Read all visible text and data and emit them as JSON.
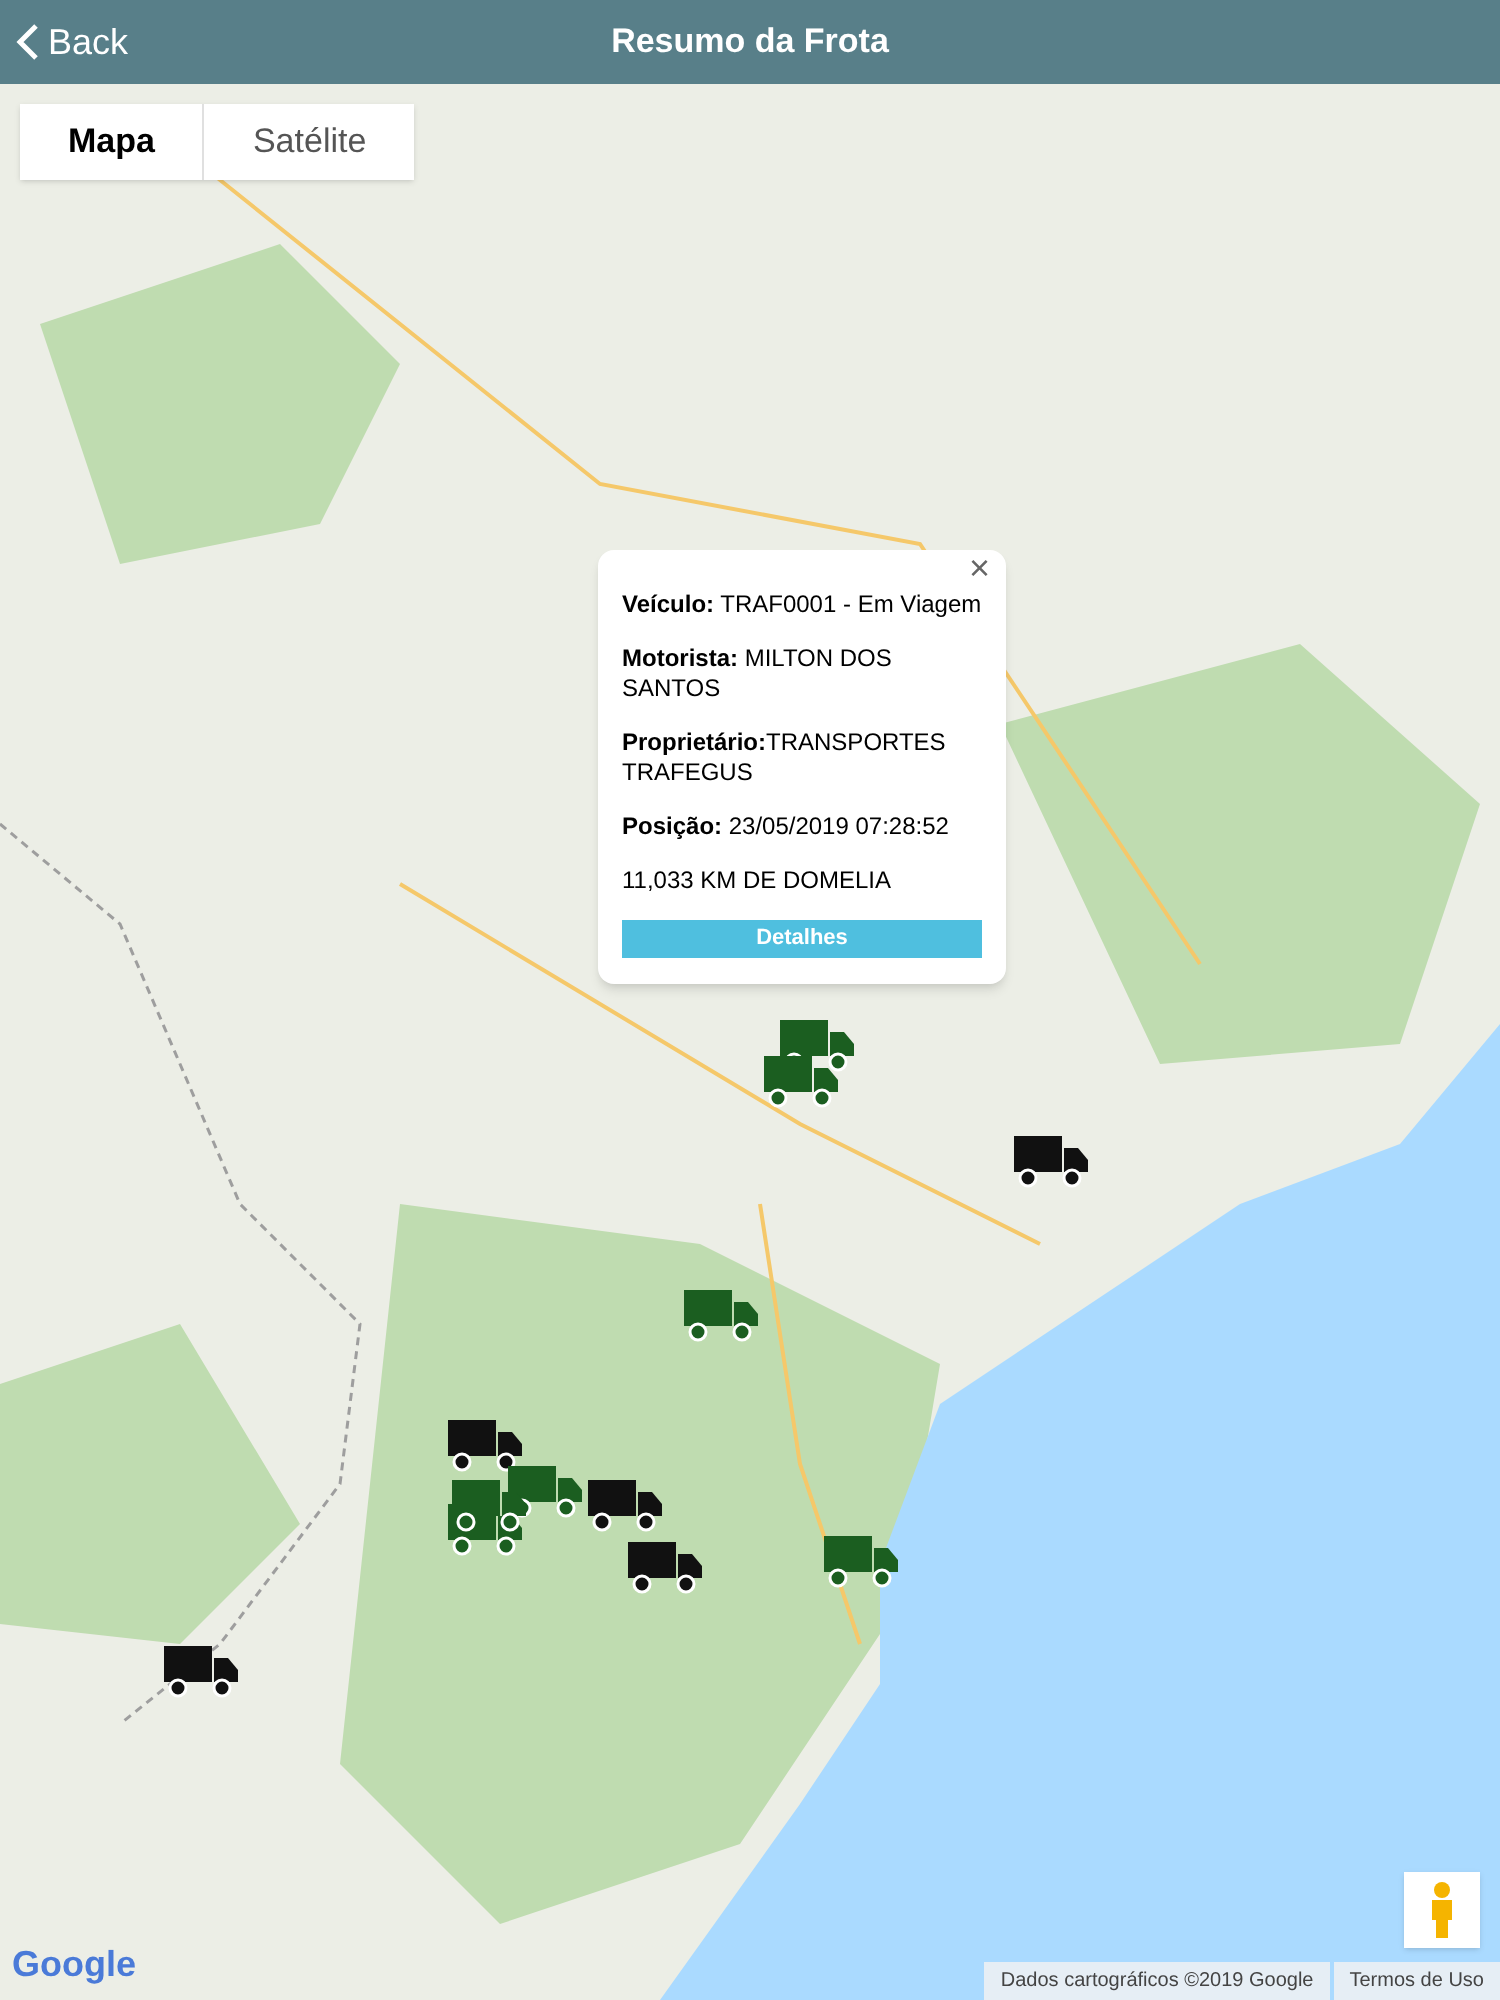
{
  "header": {
    "back_label": "Back",
    "title": "Resumo da Frota"
  },
  "map_type_tabs": [
    {
      "label": "Mapa",
      "selected": true
    },
    {
      "label": "Satélite",
      "selected": false
    }
  ],
  "info_popup": {
    "close": "×",
    "lines": [
      "**Veículo:** TRAF0001 - Em Viagem",
      "**Motorista:** MILTON DOS SANTOS",
      "**Proprietário:**TRANSPORTES TRAFEGUS",
      "**Posição:** 23/05/2019 07:28:52",
      "11,033 KM DE DOMELIA"
    ],
    "button": "Detalhes"
  },
  "markers": [
    {
      "color": "#1b5e20"
    },
    {
      "color": "#1b5e20"
    },
    {
      "color": "#111111"
    },
    {
      "color": "#1b5e20"
    },
    {
      "color": "#111111"
    },
    {
      "color": "#1b5e20"
    },
    {
      "color": "#1b5e20"
    },
    {
      "color": "#1b5e20"
    },
    {
      "color": "#111111"
    },
    {
      "color": "#111111"
    },
    {
      "color": "#1b5e20"
    },
    {
      "color": "#111111"
    }
  ],
  "footer": {
    "logo": "Google",
    "attribution": "Dados cartográficos ©2019 Google",
    "terms": "Termos de Uso"
  }
}
